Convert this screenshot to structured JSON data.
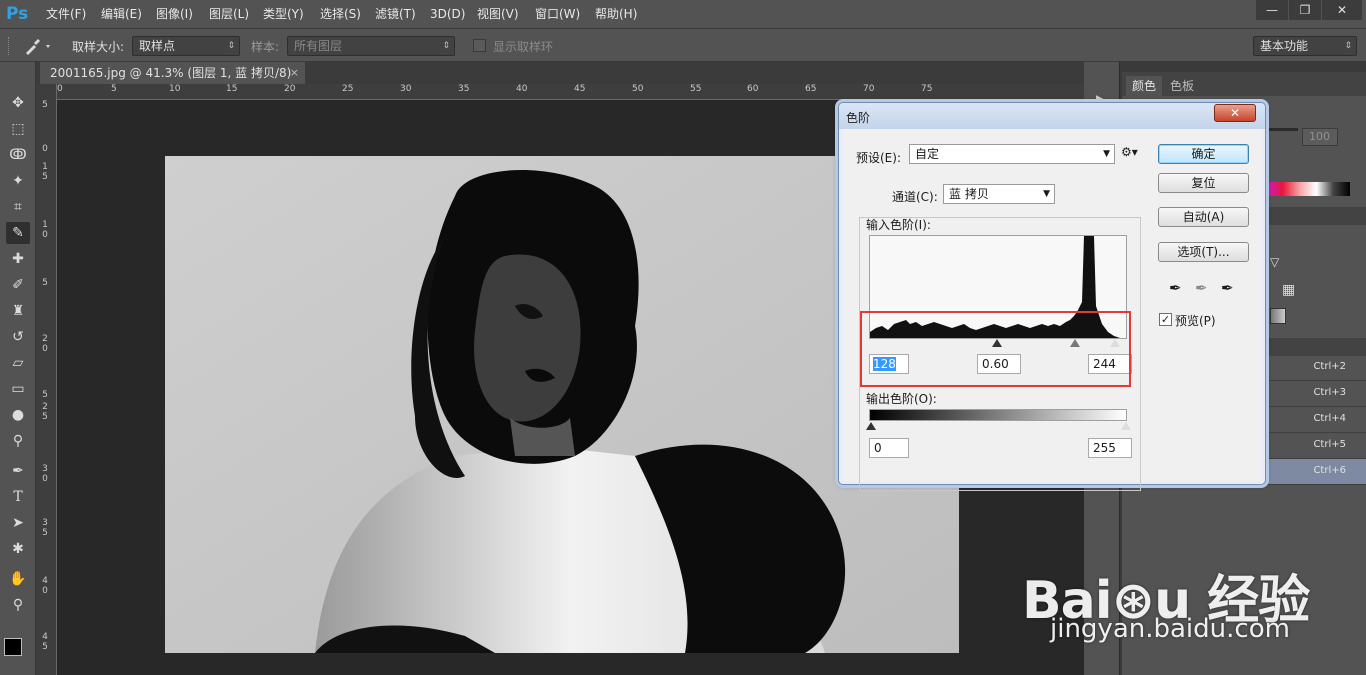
{
  "app": {
    "logo": "Ps",
    "menu": [
      "文件(F)",
      "编辑(E)",
      "图像(I)",
      "图层(L)",
      "类型(Y)",
      "选择(S)",
      "滤镜(T)",
      "3D(D)",
      "视图(V)",
      "窗口(W)",
      "帮助(H)"
    ],
    "window_controls": [
      "—",
      "❐",
      "✕"
    ]
  },
  "options": {
    "sample_size_label": "取样大小:",
    "sample_size_value": "取样点",
    "sample_label": "样本:",
    "sample_value": "所有图层",
    "show_ring_label": "显示取样环",
    "workspace": "基本功能"
  },
  "document": {
    "tab_title": "2001165.jpg @ 41.3% (图层 1, 蓝 拷贝/8) *",
    "close": "×",
    "ruler_h": [
      "0",
      "5",
      "10",
      "15",
      "20",
      "25",
      "30",
      "35",
      "40",
      "45",
      "50",
      "55",
      "60",
      "65",
      "70",
      "75"
    ],
    "ruler_v": [
      "5",
      "0",
      "1",
      "5",
      "1",
      "0",
      "5",
      "2",
      "0",
      "5",
      "2",
      "5",
      "3",
      "0",
      "3",
      "5",
      "4",
      "0",
      "4",
      "5"
    ]
  },
  "right_panel": {
    "tabs": [
      "颜色",
      "色板"
    ],
    "opacity_value": "100",
    "shortcuts": [
      "Ctrl+2",
      "Ctrl+3",
      "Ctrl+4",
      "Ctrl+5",
      "Ctrl+6"
    ]
  },
  "levels_dialog": {
    "title": "色阶",
    "close": "✕",
    "preset_label": "预设(E):",
    "preset_value": "自定",
    "channel_label": "通道(C):",
    "channel_value": "蓝 拷贝",
    "input_label": "输入色阶(I):",
    "input_black": "128",
    "input_gamma": "0.60",
    "input_white": "244",
    "output_label": "输出色阶(O):",
    "output_black": "0",
    "output_white": "255",
    "buttons": {
      "ok": "确定",
      "reset": "复位",
      "auto": "自动(A)",
      "options": "选项(T)..."
    },
    "preview_label": "预览(P)",
    "preview_checked": true
  },
  "watermark": {
    "brand": "Bai⊛u 经验",
    "url": "jingyan.baidu.com"
  }
}
